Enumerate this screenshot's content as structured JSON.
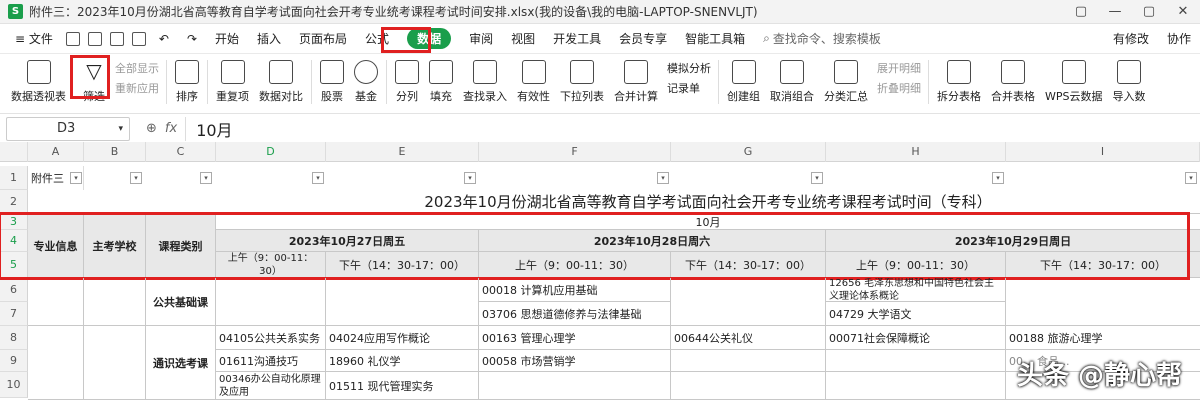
{
  "window": {
    "app_logo": "S",
    "title": "附件三：2023年10月份湖北省高等教育自学考试面向社会开考专业统考课程考试时间安排.xlsx(我的设备\\我的电脑-LAPTOP-SNENVLJT)",
    "controls": [
      "▢",
      "—",
      "▢",
      "✕"
    ]
  },
  "menu": {
    "file": "≡ 文件",
    "tabs": [
      "开始",
      "插入",
      "页面布局",
      "公式",
      "数据",
      "审阅",
      "视图",
      "开发工具",
      "会员专享",
      "智能工具箱"
    ],
    "active_tab": "数据",
    "search": "查找命令、搜索模板",
    "right": [
      "有修改",
      "协作"
    ]
  },
  "ribbon": {
    "pivot": "数据透视表",
    "filter": "筛选",
    "show_all": "全部显示",
    "reapply": "重新应用",
    "sort": "排序",
    "duplicates": "重复项",
    "compare": "数据对比",
    "stock": "股票",
    "fund": "基金",
    "split": "分列",
    "fill": "填充",
    "lookup": "查找录入",
    "validity": "有效性",
    "dropdown": "下拉列表",
    "consolidate": "合并计算",
    "whatif": "模拟分析",
    "record": "记录单",
    "group": "创建组",
    "ungroup": "取消组合",
    "subtotal": "分类汇总",
    "expand": "展开明细",
    "collapse": "折叠明细",
    "split_sheet": "拆分表格",
    "merge_sheet": "合并表格",
    "wps_cloud": "WPS云数据",
    "import": "导入数"
  },
  "formula": {
    "cell_ref": "D3",
    "fx": "fx",
    "value": "10月"
  },
  "columns": [
    "A",
    "B",
    "C",
    "D",
    "E",
    "F",
    "G",
    "H",
    "I"
  ],
  "rows": [
    "1",
    "2",
    "3",
    "4",
    "5",
    "6",
    "7",
    "8",
    "9",
    "10"
  ],
  "sheet": {
    "a1": "附件三",
    "title": "2023年10月份湖北省高等教育自学考试面向社会开考专业统考课程考试时间（专科）",
    "h_major": "专业信息",
    "h_school": "主考学校",
    "h_type": "课程类别",
    "h_month": "10月",
    "day1": "2023年10月27日周五",
    "day2": "2023年10月28日周六",
    "day3": "2023年10月29日周日",
    "am": "上午（9：00-11：30）",
    "am_wrap": "上午（9：00-11：30）",
    "pm": "下午（14：30-17：00）",
    "cat_public": "公共基础课",
    "cat_general": "通识选考课",
    "f6": "00018 计算机应用基础",
    "h6": "12656 毛泽东思想和中国特色社会主义理论体系概论",
    "f7": "03706 思想道德修养与法律基础",
    "h7": "04729 大学语文",
    "d8": "04105公共关系实务",
    "e8": "04024应用写作概论",
    "f8": "00163 管理心理学",
    "g8": "00644公关礼仪",
    "h8": "00071社会保障概论",
    "i8": "00188 旅游心理学",
    "d9": "01611沟通技巧",
    "e9": "18960 礼仪学",
    "f9": "00058 市场营销学",
    "i9": "00... 食品...",
    "d10": "00346办公自动化原理及应用",
    "e10": "01511 现代管理实务"
  },
  "watermark": "头条 @静心帮"
}
